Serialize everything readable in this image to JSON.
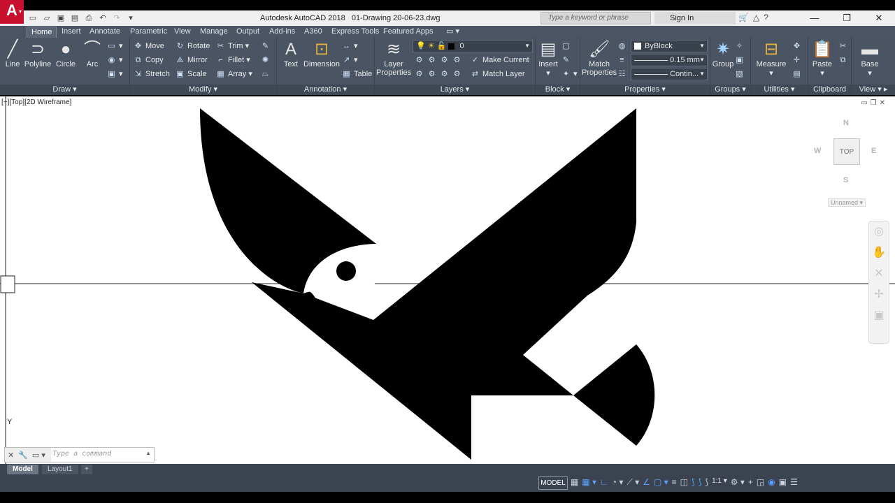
{
  "title": {
    "app_name": "Autodesk AutoCAD 2018",
    "file_name": "01-Drawing 20-06-23.dwg",
    "search_placeholder": "Type a keyword or phrase",
    "sign_in": "Sign In",
    "app_letter": "A"
  },
  "tabs": [
    "Home",
    "Insert",
    "Annotate",
    "Parametric",
    "View",
    "Manage",
    "Output",
    "Add-ins",
    "A360",
    "Express Tools",
    "Featured Apps"
  ],
  "ribbon": {
    "draw": {
      "title": "Draw",
      "line": "Line",
      "polyline": "Polyline",
      "circle": "Circle",
      "arc": "Arc"
    },
    "modify": {
      "title": "Modify",
      "move": "Move",
      "rotate": "Rotate",
      "trim": "Trim",
      "copy": "Copy",
      "mirror": "Mirror",
      "fillet": "Fillet",
      "stretch": "Stretch",
      "scale": "Scale",
      "array": "Array"
    },
    "annotation": {
      "title": "Annotation",
      "text": "Text",
      "dimension": "Dimension",
      "table": "Table"
    },
    "layers": {
      "title": "Layers",
      "layer_properties": [
        "Layer",
        "Properties"
      ],
      "current_layer": "0",
      "make_current": "Make Current",
      "match_layer": "Match Layer"
    },
    "block": {
      "title": "Block",
      "insert": "Insert"
    },
    "properties": {
      "title": "Properties",
      "match_properties": [
        "Match",
        "Properties"
      ],
      "color": "ByBlock",
      "lineweight": "0.15 mm",
      "linetype": "Contin..."
    },
    "groups": {
      "title": "Groups",
      "group": "Group"
    },
    "utilities": {
      "title": "Utilities",
      "measure": "Measure"
    },
    "clipboard": {
      "title": "Clipboard",
      "paste": "Paste"
    },
    "view": {
      "title": "View",
      "base": "Base"
    }
  },
  "viewport": {
    "label": "[−][Top][2D Wireframe]"
  },
  "viewcube": {
    "top": "TOP",
    "north": "N",
    "south": "S",
    "east": "E",
    "west": "W",
    "wcs": "Unnamed"
  },
  "ucs": {
    "y": "Y"
  },
  "command": {
    "placeholder": "Type a command"
  },
  "layout_tabs": [
    "Model",
    "Layout1"
  ],
  "status": {
    "model": "MODEL",
    "scale": "1:1"
  }
}
